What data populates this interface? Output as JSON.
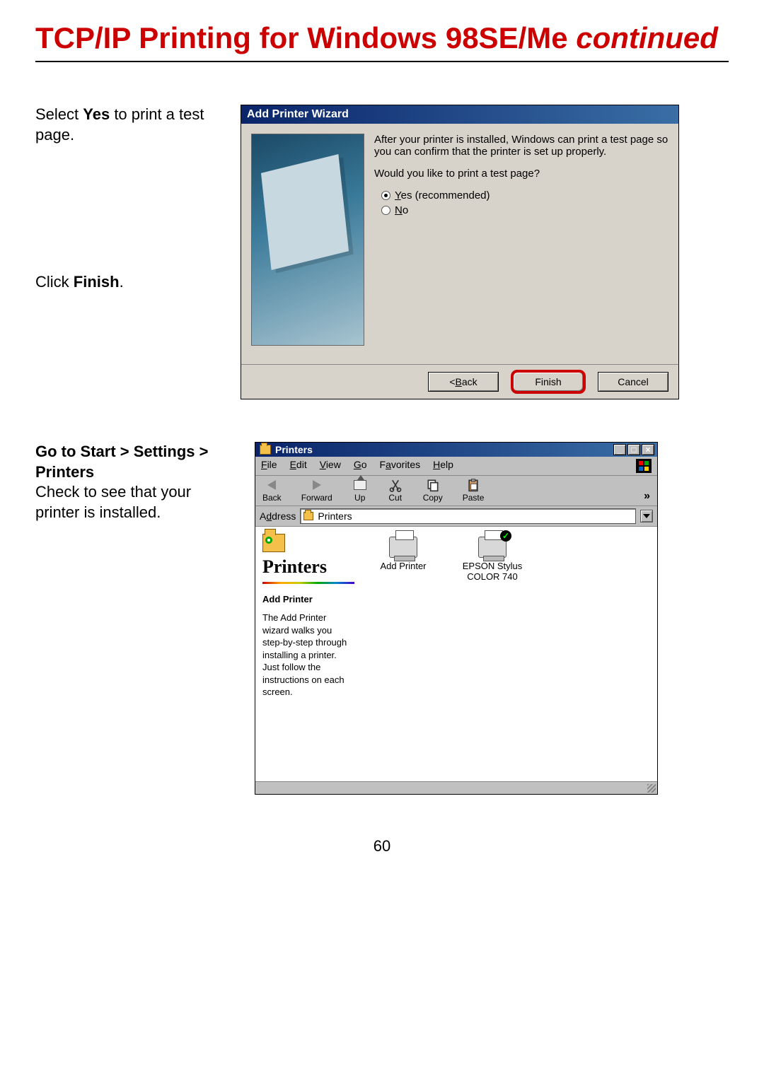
{
  "page": {
    "title_main": "TCP/IP Printing for Windows 98SE/Me ",
    "title_cont": "continued",
    "number": "60"
  },
  "instructions": {
    "step1_pre": "Select ",
    "step1_b": "Yes",
    "step1_post": " to print a test page.",
    "step2_pre": "Click ",
    "step2_b": "Finish",
    "step2_post": ".",
    "step3_line1": "Go to Start > Settings > Printers",
    "step3_line2": "Check to see that your printer is installed."
  },
  "wizard": {
    "title": "Add Printer Wizard",
    "text1": "After your printer is installed, Windows can print a test page so you can confirm that the printer is set up properly.",
    "text2": "Would you like to print a test page?",
    "opt_yes_u": "Y",
    "opt_yes_rest": "es (recommended)",
    "opt_no_u": "N",
    "opt_no_rest": "o",
    "btn_back_pre": "< ",
    "btn_back_u": "B",
    "btn_back_rest": "ack",
    "btn_finish": "Finish",
    "btn_cancel": "Cancel"
  },
  "printers": {
    "title": "Printers",
    "menu": {
      "file_u": "F",
      "file_rest": "ile",
      "edit_u": "E",
      "edit_rest": "dit",
      "view_u": "V",
      "view_rest": "iew",
      "go_u": "G",
      "go_rest": "o",
      "fav_pre": "F",
      "fav_u": "a",
      "fav_rest": "vorites",
      "help_u": "H",
      "help_rest": "elp"
    },
    "toolbar": {
      "back": "Back",
      "forward": "Forward",
      "up": "Up",
      "cut": "Cut",
      "copy": "Copy",
      "paste": "Paste"
    },
    "address_label_pre": "A",
    "address_label_u": "d",
    "address_label_rest": "dress",
    "address_value": "Printers",
    "side": {
      "title": "Printers",
      "subtitle": "Add Printer",
      "desc": "The Add Printer wizard walks you step-by-step through installing a printer. Just follow the instructions on each screen."
    },
    "items": {
      "add": "Add Printer",
      "epson_l1": "EPSON Stylus",
      "epson_l2": "COLOR 740"
    }
  }
}
